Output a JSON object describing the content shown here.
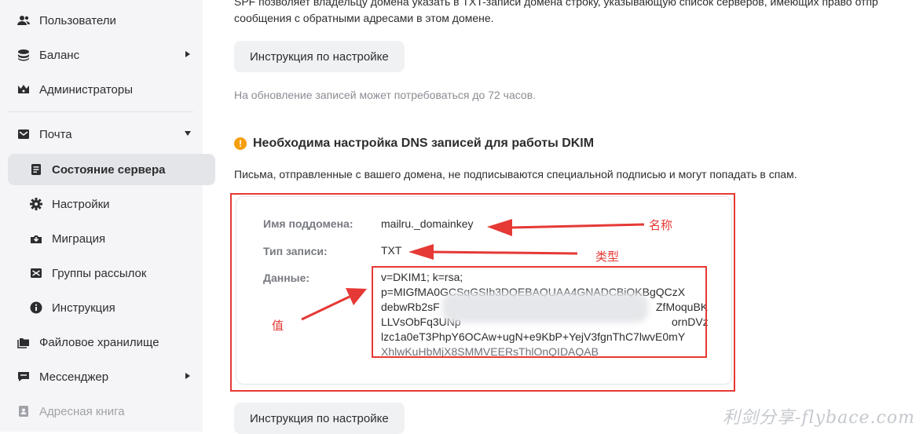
{
  "sidebar": {
    "items": [
      {
        "label": "Пользователи",
        "icon": "users-icon"
      },
      {
        "label": "Баланс",
        "icon": "coins-icon",
        "expandable": true
      },
      {
        "label": "Администраторы",
        "icon": "admin-crown-icon"
      },
      {
        "label": "Почта",
        "icon": "mail-icon",
        "expanded": true
      },
      {
        "label": "Состояние сервера",
        "icon": "server-state-icon",
        "active": true
      },
      {
        "label": "Настройки",
        "icon": "gear-icon"
      },
      {
        "label": "Миграция",
        "icon": "migration-icon"
      },
      {
        "label": "Группы рассылок",
        "icon": "mailing-groups-icon"
      },
      {
        "label": "Инструкция",
        "icon": "info-icon"
      },
      {
        "label": "Файловое хранилище",
        "icon": "folder-icon"
      },
      {
        "label": "Мессенджер",
        "icon": "messenger-icon",
        "expandable": true
      },
      {
        "label": "Адресная книга",
        "icon": "address-book-icon",
        "disabled": true
      }
    ]
  },
  "main": {
    "spf_text_line1": "SPF позволяет владельцу домена указать в TXT-записи домена строку, указывающую список серверов, имеющих право отпр",
    "spf_text_line2": "сообщения с обратными адресами в этом домене.",
    "instruction_button": "Инструкция по настройке",
    "update_note": "На обновление записей может потребоваться до 72 часов.",
    "dkim_title": "Необходима настройка DNS записей для работы DKIM",
    "dkim_desc": "Письма, отправленные с вашего домена, не подписываются специальной подписью и могут попадать в спам.",
    "dns": {
      "subdomain_label": "Имя поддомена:",
      "subdomain_value": "mailru._domainkey",
      "type_label": "Тип записи:",
      "type_value": "TXT",
      "data_label": "Данные:",
      "data_lines": [
        "v=DKIM1; k=rsa;",
        "p=MIGfMA0GCSqGSIb3DQEBAQUAA4GNADCBiQKBgQCzX",
        "debwRb2sF",
        "ZfMoquBK",
        "LLVsObFq3UNp",
        "ornDVz",
        "lzc1a0eT3PhpY6OCAw+ugN+e9KbP+YejV3fgnThC7lwvE0mY",
        "XhlwKuHbMjX8SMMVEERsThlOnQIDAQAB"
      ]
    },
    "instruction_button_2": "Инструкция по настройке"
  },
  "annotations": {
    "name": "名称",
    "type": "类型",
    "value": "值",
    "color": "#e53935"
  },
  "watermark": "利剑分享-flybace.com"
}
